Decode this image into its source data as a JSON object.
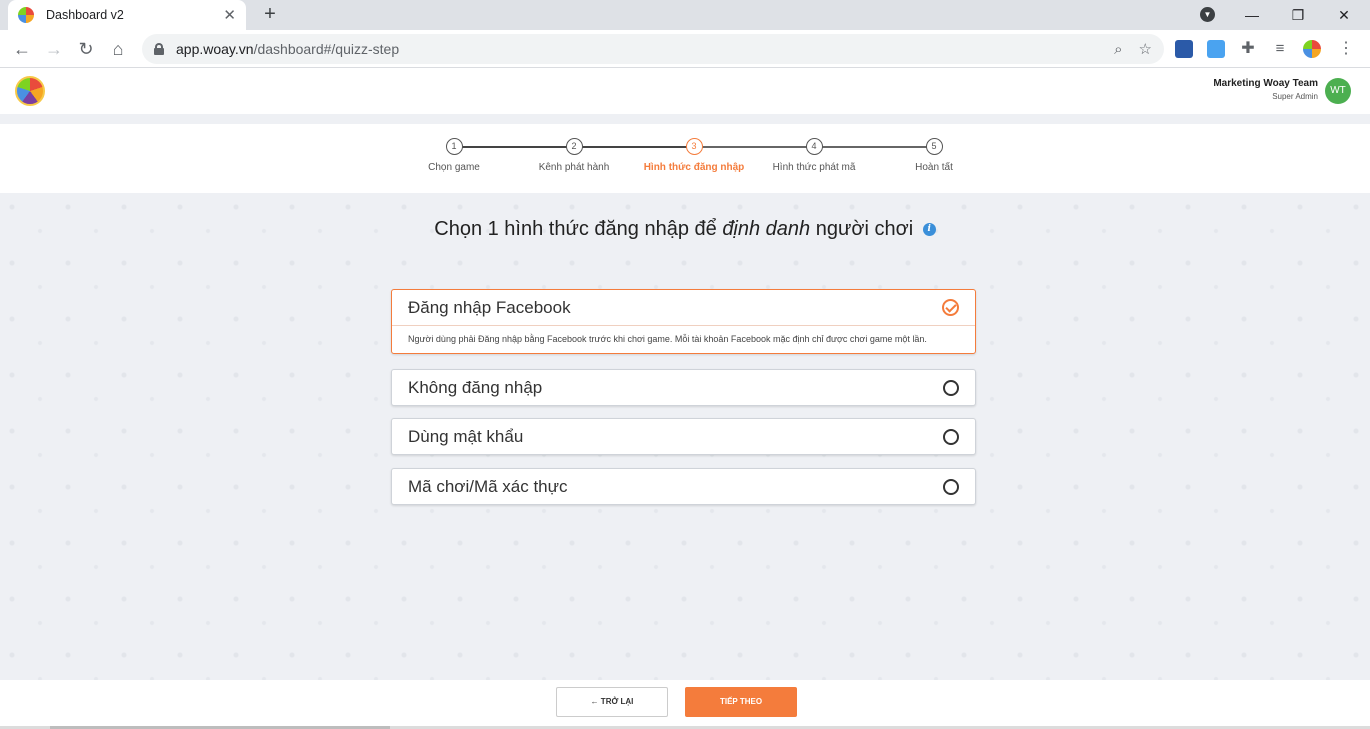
{
  "browser": {
    "tab_title": "Dashboard v2",
    "tab_close": "✕",
    "new_tab": "+",
    "url_host": "app.woay.vn",
    "url_path": "/dashboard#/quizz-step",
    "window_min": "—",
    "window_restore": "❐",
    "window_close": "✕"
  },
  "header": {
    "user_name": "Marketing Woay Team",
    "user_role": "Super Admin",
    "avatar_initials": "WT"
  },
  "stepper": {
    "active_step": 3,
    "steps": [
      {
        "num": "1",
        "label": "Chọn game"
      },
      {
        "num": "2",
        "label": "Kênh phát hành"
      },
      {
        "num": "3",
        "label": "Hình thức đăng nhập"
      },
      {
        "num": "4",
        "label": "Hình thức phát mã"
      },
      {
        "num": "5",
        "label": "Hoàn tất"
      }
    ]
  },
  "main": {
    "heading_prefix": "Chọn 1 hình thức đăng nhập để ",
    "heading_emphasis": "định danh",
    "heading_suffix": " người chơi",
    "info_icon": "i",
    "options": [
      {
        "label": "Đăng nhập Facebook",
        "selected": true,
        "description": "Người dùng phải Đăng nhập bằng Facebook trước khi chơi game. Mỗi tài khoản Facebook mặc định chỉ được chơi game một lần."
      },
      {
        "label": "Không đăng nhập",
        "selected": false
      },
      {
        "label": "Dùng mật khẩu",
        "selected": false
      },
      {
        "label": "Mã chơi/Mã xác thực",
        "selected": false
      }
    ]
  },
  "footer": {
    "back_label": "← TRỞ LẠI",
    "next_label": "TIẾP THEO"
  },
  "colors": {
    "accent": "#f47c3c",
    "avatar": "#4caf50",
    "info": "#3a8fd9"
  }
}
